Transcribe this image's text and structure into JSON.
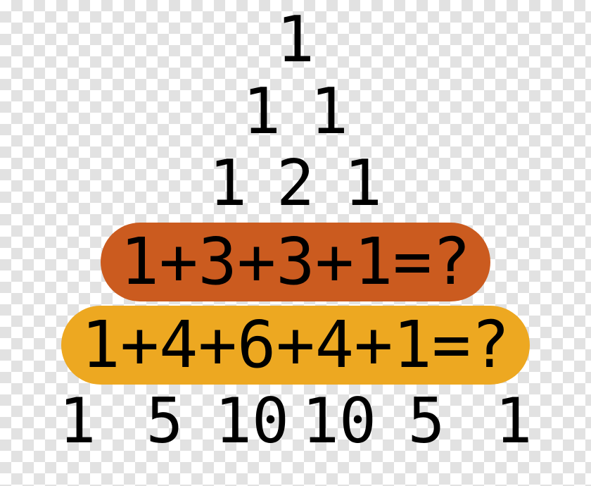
{
  "triangle": {
    "rows": [
      {
        "type": "plain",
        "cells": [
          "1"
        ]
      },
      {
        "type": "plain",
        "cells": [
          "1",
          "1"
        ]
      },
      {
        "type": "plain",
        "cells": [
          "1",
          "2",
          "1"
        ]
      },
      {
        "type": "pill_orange",
        "text": "1+3+3+1=?"
      },
      {
        "type": "pill_amber",
        "text": "1+4+6+4+1=?"
      },
      {
        "type": "plain_last",
        "cells": [
          "1",
          "5",
          "10",
          "10",
          "5",
          "1"
        ]
      }
    ]
  },
  "colors": {
    "orange": "#cb5b1f",
    "amber": "#eda821"
  }
}
